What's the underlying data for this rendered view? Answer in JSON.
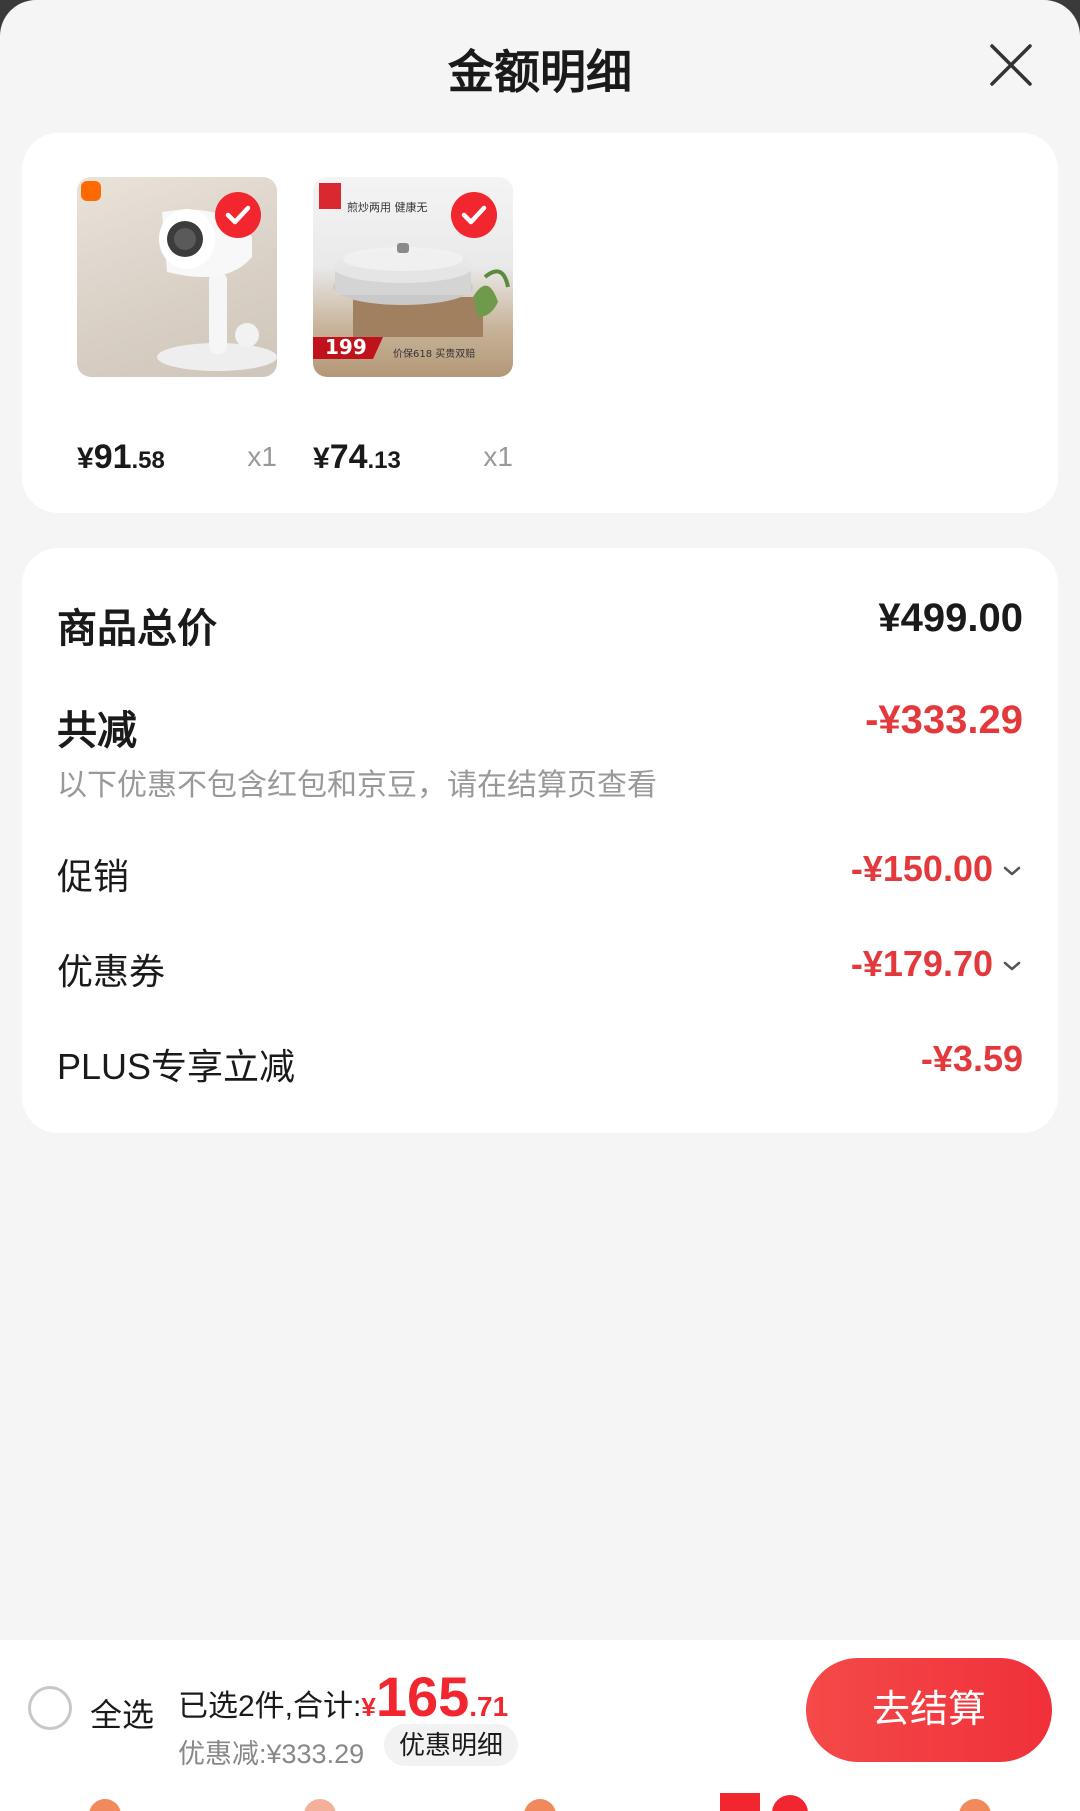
{
  "sheet": {
    "title": "金额明细"
  },
  "products": [
    {
      "name": "hair-dryer",
      "price_int": "91",
      "price_dec": ".58",
      "qty": "x1",
      "selected": true
    },
    {
      "name": "cooking-pot",
      "price_int": "74",
      "price_dec": ".13",
      "qty": "x1",
      "selected": true,
      "image_text": {
        "banner": "煎炒两用 健康无",
        "price_tag": "199",
        "bottom": "价保618 买贵双赔"
      }
    }
  ],
  "currency": "¥",
  "summary": {
    "total_label": "商品总价",
    "total_value": "¥499.00",
    "reduce_label": "共减",
    "reduce_value": "-¥333.29",
    "reduce_note": "以下优惠不包含红包和京豆，请在结算页查看",
    "items": [
      {
        "label": "促销",
        "value": "-¥150.00",
        "expandable": true
      },
      {
        "label": "优惠券",
        "value": "-¥179.70",
        "expandable": true
      },
      {
        "label": "PLUS专享立减",
        "value": "-¥3.59",
        "expandable": false
      }
    ]
  },
  "bottom_bar": {
    "select_all": "全选",
    "selected_text": "已选2件,合计:",
    "total_yen": "¥",
    "total_int": "165",
    "total_dec": ".71",
    "discount_text": "优惠减:¥333.29",
    "detail_button": "优惠明细",
    "checkout_button": "去结算"
  },
  "colors": {
    "accent_red": "#e4393c",
    "checkout_red": "#f2262f",
    "background": "#f5f5f5"
  }
}
